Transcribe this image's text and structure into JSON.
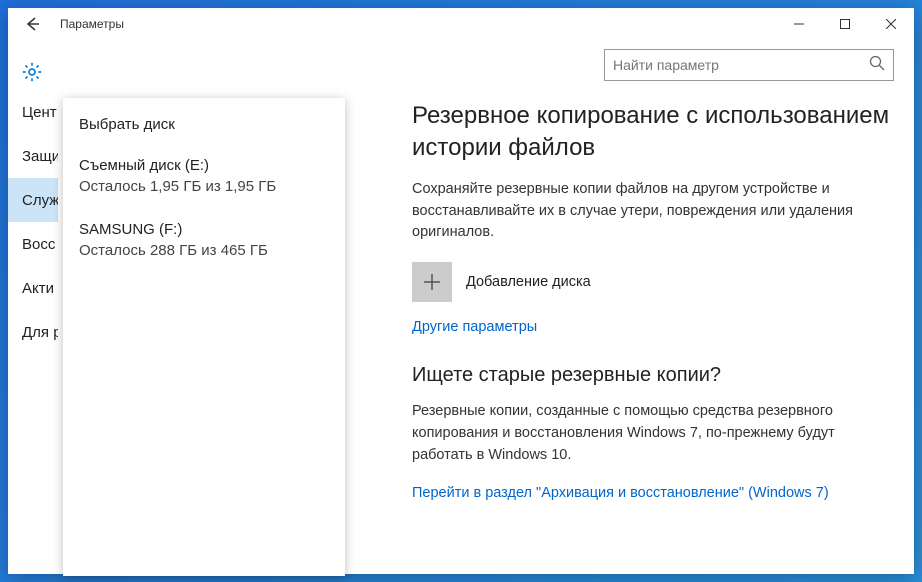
{
  "titlebar": {
    "title": "Параметры"
  },
  "search": {
    "placeholder": "Найти параметр"
  },
  "sidebar": {
    "items": [
      {
        "label": "Цент"
      },
      {
        "label": "Защи"
      },
      {
        "label": "Служ"
      },
      {
        "label": "Восс"
      },
      {
        "label": "Акти"
      },
      {
        "label": "Для р"
      }
    ],
    "selectedIndex": 2
  },
  "dropdown": {
    "title": "Выбрать диск",
    "disks": [
      {
        "name": "Съемный диск (E:)",
        "info": "Осталось 1,95 ГБ из 1,95 ГБ"
      },
      {
        "name": "SAMSUNG (F:)",
        "info": "Осталось 288 ГБ из 465 ГБ"
      }
    ]
  },
  "main": {
    "heading1": "Резервное копирование с использованием истории файлов",
    "desc1": "Сохраняйте резервные копии файлов на другом устройстве и восстанавливайте их в случае утери, повреждения или удаления оригиналов.",
    "addDisk": "Добавление диска",
    "otherParams": "Другие параметры",
    "heading2": "Ищете старые резервные копии?",
    "desc2": "Резервные копии, созданные с помощью средства резервного копирования и восстановления Windows 7, по-прежнему будут работать в Windows 10.",
    "link2": "Перейти в раздел \"Архивация и восстановление\" (Windows 7)"
  }
}
